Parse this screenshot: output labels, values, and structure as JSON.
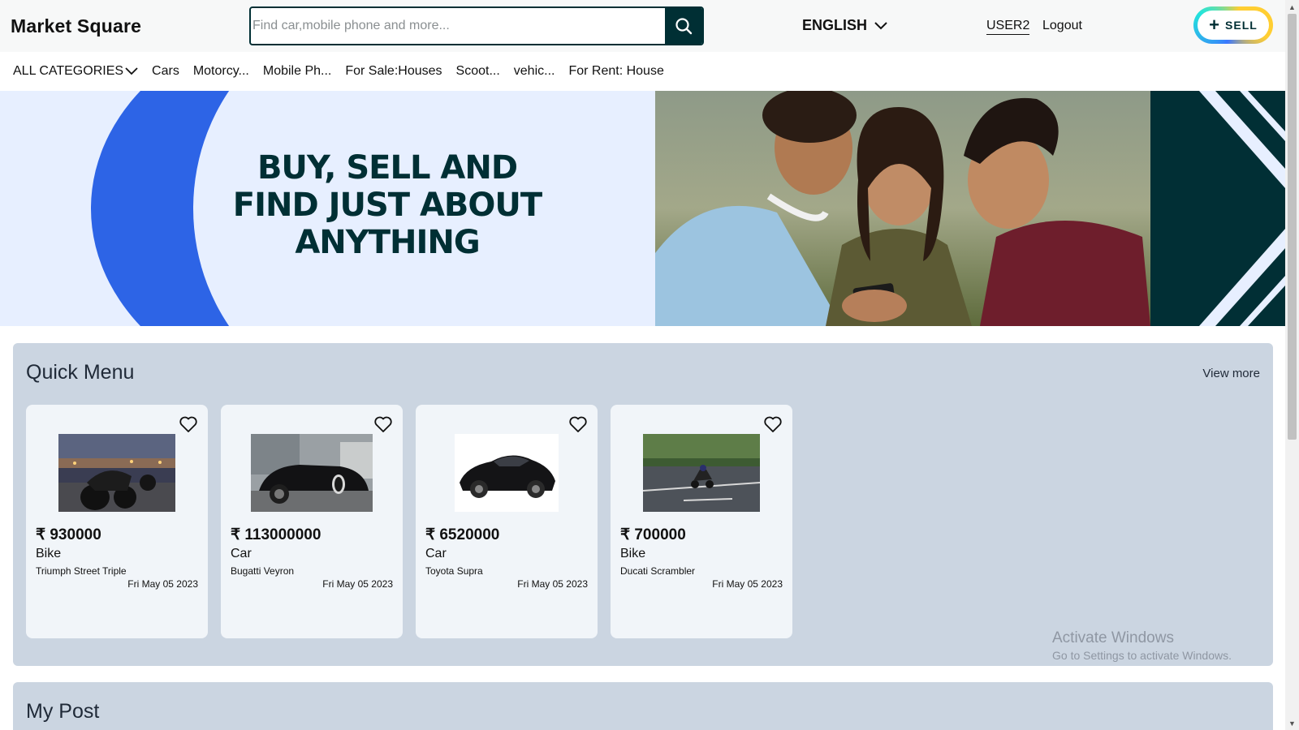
{
  "header": {
    "logo": "Market Square",
    "search_placeholder": "Find car,mobile phone and more...",
    "language": "ENGLISH",
    "user": "USER2",
    "logout": "Logout",
    "sell": "SELL"
  },
  "categories": {
    "all": "ALL CATEGORIES",
    "items": [
      "Cars",
      "Motorcy...",
      "Mobile Ph...",
      "For Sale:Houses",
      "Scoot...",
      "vehic...",
      "For Rent: House"
    ]
  },
  "banner": {
    "line1": "BUY, SELL AND",
    "line2": "FIND JUST ABOUT",
    "line3": "ANYTHING"
  },
  "quick_menu": {
    "title": "Quick Menu",
    "view_more": "View more",
    "cards": [
      {
        "price": "₹ 930000",
        "type": "Bike",
        "name": "Triumph Street Triple",
        "date": "Fri May 05 2023"
      },
      {
        "price": "₹ 113000000",
        "type": "Car",
        "name": "Bugatti Veyron",
        "date": "Fri May 05 2023"
      },
      {
        "price": "₹ 6520000",
        "type": "Car",
        "name": "Toyota Supra",
        "date": "Fri May 05 2023"
      },
      {
        "price": "₹ 700000",
        "type": "Bike",
        "name": "Ducati Scrambler",
        "date": "Fri May 05 2023"
      }
    ]
  },
  "my_post": {
    "title": "My Post"
  },
  "watermark": {
    "line1": "Activate Windows",
    "line2": "Go to Settings to activate Windows."
  },
  "colors": {
    "brand_dark": "#002f34",
    "banner_blue": "#2d64e6",
    "section_bg": "#cbd5e1",
    "card_bg": "#f1f5f9"
  },
  "icons": {
    "search": "search-icon",
    "chevron": "chevron-down-icon",
    "heart": "heart-icon",
    "plus": "plus-icon"
  }
}
